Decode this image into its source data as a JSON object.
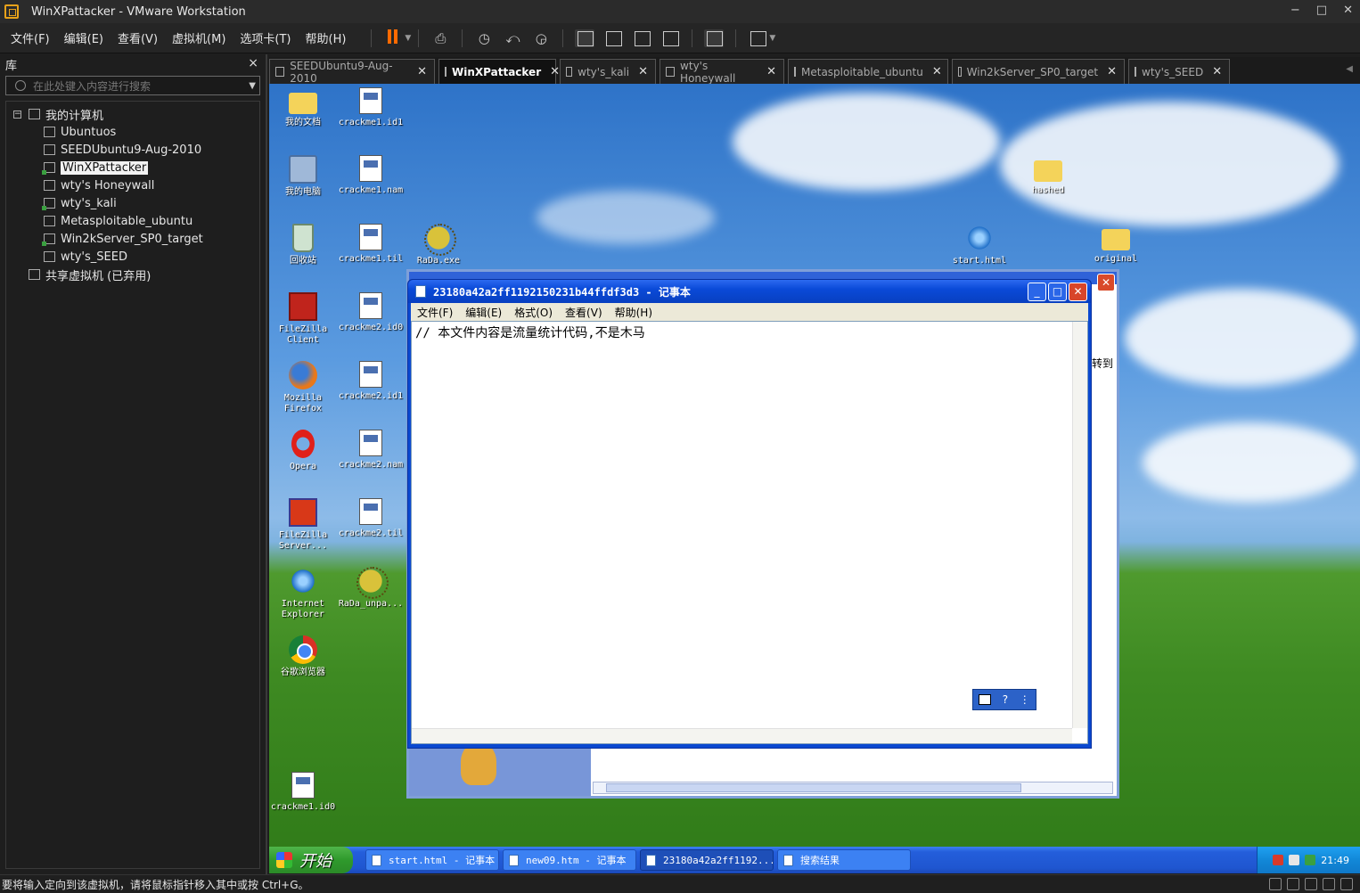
{
  "window": {
    "title": "WinXPattacker - VMware Workstation",
    "minimize_glyph": "−",
    "maximize_glyph": "□",
    "close_glyph": "✕"
  },
  "menu": [
    "文件(F)",
    "编辑(E)",
    "查看(V)",
    "虚拟机(M)",
    "选项卡(T)",
    "帮助(H)"
  ],
  "toolbar": {
    "accent_color": "#ff6a00",
    "icons": [
      "pause-icon",
      "send-ctrl-alt-del-icon",
      "snapshot-icon",
      "revert-snapshot-icon",
      "snapshot-manager-icon",
      "library-view-icon",
      "thumbnail-view-icon",
      "fullscreen-icon",
      "unity-icon",
      "console-icon",
      "stretch-icon"
    ]
  },
  "library": {
    "title": "库",
    "close_glyph": "×",
    "search_placeholder": "在此处键入内容进行搜索",
    "tree": {
      "root": "我的计算机",
      "root_expander": "−",
      "vms": [
        {
          "label": "Ubuntuos",
          "running": false
        },
        {
          "label": "SEEDUbuntu9-Aug-2010",
          "running": false
        },
        {
          "label": "WinXPattacker",
          "running": true,
          "selected": true
        },
        {
          "label": "wty's Honeywall",
          "running": false
        },
        {
          "label": "wty's_kali",
          "running": true
        },
        {
          "label": "Metasploitable_ubuntu",
          "running": false
        },
        {
          "label": "Win2kServer_SP0_target",
          "running": true
        },
        {
          "label": "wty's_SEED",
          "running": false
        }
      ],
      "shared": "共享虚拟机 (已弃用)"
    }
  },
  "tabs": [
    {
      "label": "SEEDUbuntu9-Aug-2010",
      "active": false
    },
    {
      "label": "WinXPattacker",
      "active": true
    },
    {
      "label": "wty's_kali",
      "active": false
    },
    {
      "label": "wty's Honeywall",
      "active": false
    },
    {
      "label": "Metasploitable_ubuntu",
      "active": false
    },
    {
      "label": "Win2kServer_SP0_target",
      "active": false
    },
    {
      "label": "wty's_SEED",
      "active": false
    }
  ],
  "tab_close_glyph": "✕",
  "desktop": {
    "icons": [
      {
        "label": "我的文档",
        "kind": "folder"
      },
      {
        "label": "crackme1.id1",
        "kind": "file"
      },
      {
        "label": "我的电脑",
        "kind": "computer"
      },
      {
        "label": "crackme1.nam",
        "kind": "file"
      },
      {
        "label": "回收站",
        "kind": "bin"
      },
      {
        "label": "crackme1.til",
        "kind": "file"
      },
      {
        "label": "RaDa.exe",
        "kind": "fish"
      },
      {
        "label": "FileZilla Client",
        "kind": "fz"
      },
      {
        "label": "crackme2.id0",
        "kind": "file"
      },
      {
        "label": "Mozilla Firefox",
        "kind": "fx"
      },
      {
        "label": "crackme2.id1",
        "kind": "file"
      },
      {
        "label": "Opera",
        "kind": "opera"
      },
      {
        "label": "crackme2.nam",
        "kind": "file"
      },
      {
        "label": "FileZilla Server...",
        "kind": "fz2"
      },
      {
        "label": "crackme2.til",
        "kind": "file"
      },
      {
        "label": "Internet Explorer",
        "kind": "ie"
      },
      {
        "label": "RaDa_unpa...",
        "kind": "fish"
      },
      {
        "label": "谷歌浏览器",
        "kind": "chrome"
      },
      {
        "label": "crackme1.id0",
        "kind": "file"
      },
      {
        "label": "hashed",
        "kind": "folder"
      },
      {
        "label": "start.html",
        "kind": "ie"
      },
      {
        "label": "original",
        "kind": "folder"
      }
    ]
  },
  "search_window": {
    "side_text": "转到",
    "close_glyph": "✕"
  },
  "notepad": {
    "title": "23180a42a2ff1192150231b44ffdf3d3 - 记事本",
    "menu": [
      "文件(F)",
      "编辑(E)",
      "格式(O)",
      "查看(V)",
      "帮助(H)"
    ],
    "content": "// 本文件内容是流量统计代码,不是木马",
    "buttons": {
      "minimize": "_",
      "maximize": "□",
      "close": "✕"
    }
  },
  "taskbar": {
    "start_label": "开始",
    "tasks": [
      {
        "label": "start.html - 记事本",
        "active": false
      },
      {
        "label": "new09.htm - 记事本",
        "active": false
      },
      {
        "label": "23180a42a2ff1192...",
        "active": true
      },
      {
        "label": "搜索结果",
        "active": false
      }
    ],
    "clock": "21:49"
  },
  "statusbar": {
    "text": "要将输入定向到该虚拟机，请将鼠标指针移入其中或按 Ctrl+G。"
  }
}
